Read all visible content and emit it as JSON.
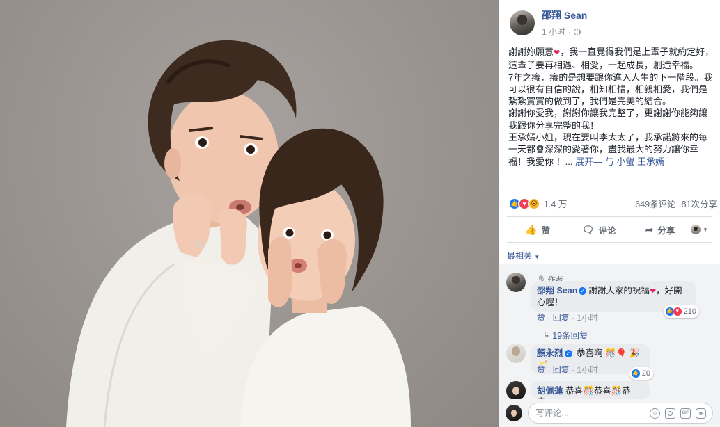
{
  "post": {
    "author": "邵翔 Sean",
    "time": "1 小时",
    "paragraphs": [
      "謝謝妳願意",
      "，我一直覺得我們是上輩子就約定好，這輩子要再相遇、相愛，一起成長，創造幸福。",
      "7年之癢，癢的是想要跟你進入人生的下一階段。我可以很有自信的說，相知相惜，相親相愛，我們是紮紮實實的做到了，我們是完美的結合。",
      "謝謝你愛我，謝謝你讓我完整了，更謝謝你能夠讓我跟你分享完整的我！",
      "王承嫣小姐，現在要叫李太太了，我承諾將來的每一天都會深深的愛著你，盡我最大的努力讓你幸福！我愛你 ！..."
    ],
    "expand_link": "展开",
    "with_text": "— 与",
    "tagged": "小螢 王承嫣",
    "heart_emoji": "❤"
  },
  "reactions": {
    "count": "1.4 万",
    "comments": "649条评论",
    "shares": "81次分享"
  },
  "actions": {
    "like": "赞",
    "comment": "评论",
    "share": "分享"
  },
  "sort": {
    "label": "最相关"
  },
  "comments": [
    {
      "author_tag": "作者",
      "name": "邵翔 Sean",
      "text_line1": "謝謝大家的祝福",
      "text_after_heart": "，好開",
      "text_line2": "心喔！",
      "reaction_count": "210",
      "like_label": "赞",
      "reply_label": "回复",
      "time": "1小时",
      "replies_label": "19条回复"
    },
    {
      "name": "顏永烈",
      "text": "恭喜啊",
      "reaction_count": "20",
      "like_label": "赞",
      "reply_label": "回复",
      "time": "1小时"
    },
    {
      "name": "胡佩蓮",
      "text": "恭喜🎊恭喜🎊恭喜…"
    }
  ],
  "composer": {
    "placeholder": "写评论..."
  },
  "colors": {
    "link": "#385898",
    "like": "#1877f2",
    "love": "#f33e58",
    "wow": "#f7b125"
  }
}
